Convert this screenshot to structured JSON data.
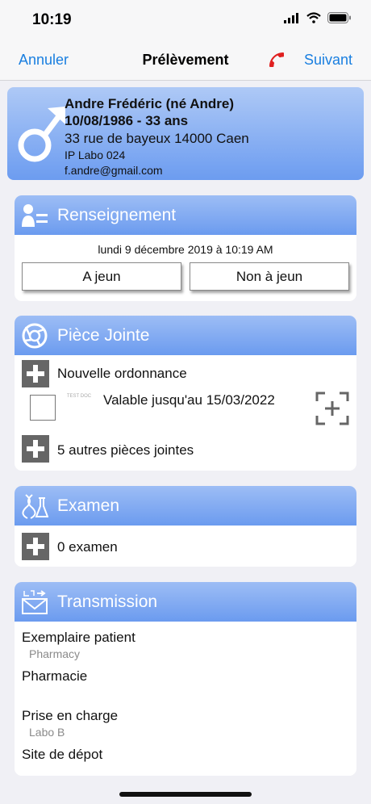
{
  "status": {
    "time": "10:19"
  },
  "nav": {
    "cancel": "Annuler",
    "title": "Prélèvement",
    "next": "Suivant",
    "phone_icon": "phone-icon"
  },
  "patient": {
    "name": "Andre Frédéric (né Andre)",
    "dob": "10/08/1986 - 33 ans",
    "address": "33 rue de bayeux 14000 Caen",
    "ip": "IP Labo 024",
    "email": "f.andre@gmail.com",
    "gender_icon": "male-icon"
  },
  "renseignement": {
    "title": "Renseignement",
    "date": "lundi 9 décembre 2019 à 10:19 AM",
    "btn_fasting": "A jeun",
    "btn_not_fasting": "Non à jeun"
  },
  "piece_jointe": {
    "title": "Pièce Jointe",
    "new_prescription": "Nouvelle ordonnance",
    "attachment_valid": "Valable jusqu'au 15/03/2022",
    "thumb_text": "TEST DOC",
    "more_attachments": "5 autres pièces jointes"
  },
  "examen": {
    "title": "Examen",
    "count": "0 examen"
  },
  "transmission": {
    "title": "Transmission",
    "items": [
      {
        "label": "Exemplaire patient",
        "sub": "Pharmacy"
      },
      {
        "label": "Pharmacie",
        "sub": ""
      },
      {
        "label": "Prise en charge",
        "sub": "Labo B"
      },
      {
        "label": "Site de dépot",
        "sub": ""
      }
    ]
  },
  "colors": {
    "accent": "#1a7fe0",
    "header_gradient_top": "#9dbdf5",
    "header_gradient_bottom": "#6b9bef",
    "phone_red": "#e02020"
  }
}
